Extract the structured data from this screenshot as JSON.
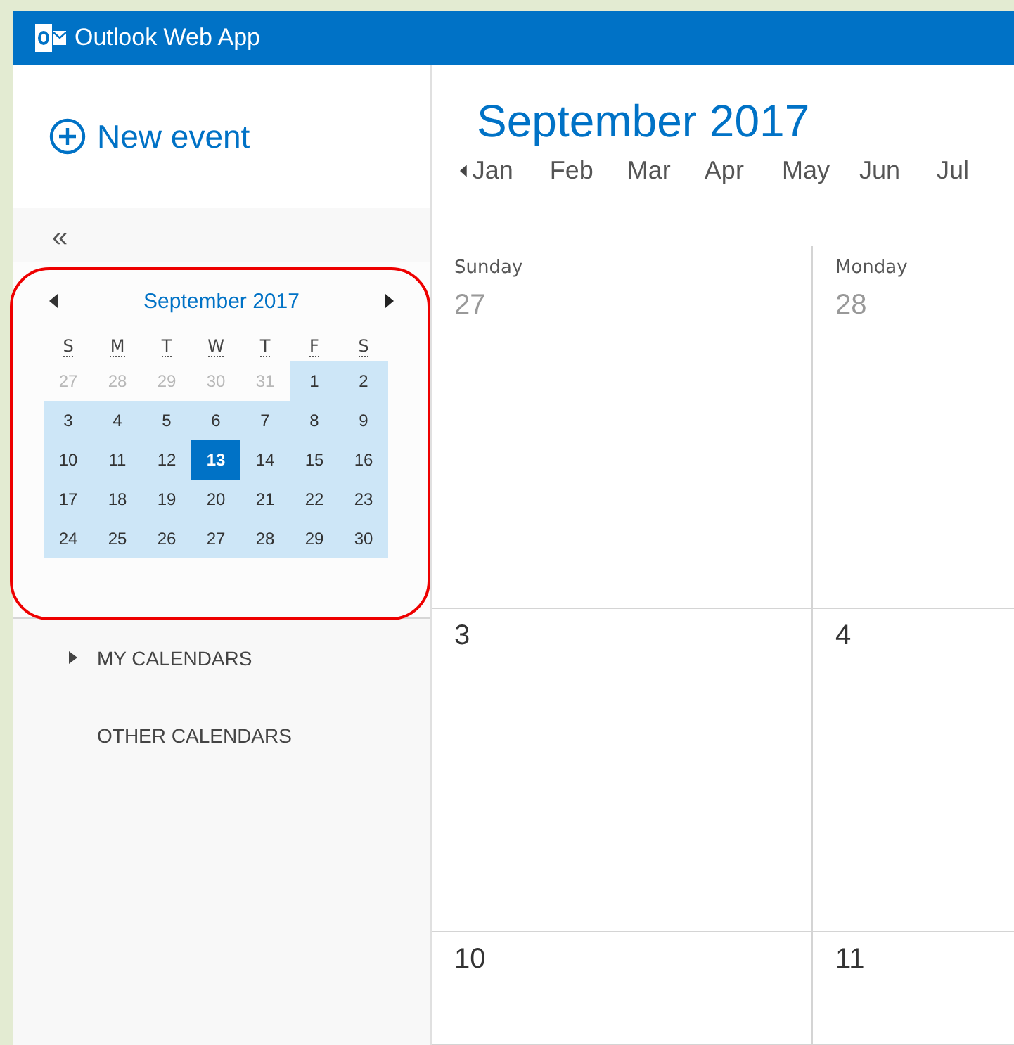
{
  "header": {
    "title": "Outlook Web App"
  },
  "new_event": {
    "label": "New event"
  },
  "collapse": {
    "label": "«"
  },
  "mini_calendar": {
    "title": "September 2017",
    "weekdays": [
      "S",
      "M",
      "T",
      "W",
      "T",
      "F",
      "S"
    ],
    "weeks": [
      [
        {
          "day": "27",
          "outside": true,
          "selected": false
        },
        {
          "day": "28",
          "outside": true,
          "selected": false
        },
        {
          "day": "29",
          "outside": true,
          "selected": false
        },
        {
          "day": "30",
          "outside": true,
          "selected": false
        },
        {
          "day": "31",
          "outside": true,
          "selected": false
        },
        {
          "day": "1",
          "outside": false,
          "selected": false
        },
        {
          "day": "2",
          "outside": false,
          "selected": false
        }
      ],
      [
        {
          "day": "3",
          "outside": false,
          "selected": false
        },
        {
          "day": "4",
          "outside": false,
          "selected": false
        },
        {
          "day": "5",
          "outside": false,
          "selected": false
        },
        {
          "day": "6",
          "outside": false,
          "selected": false
        },
        {
          "day": "7",
          "outside": false,
          "selected": false
        },
        {
          "day": "8",
          "outside": false,
          "selected": false
        },
        {
          "day": "9",
          "outside": false,
          "selected": false
        }
      ],
      [
        {
          "day": "10",
          "outside": false,
          "selected": false
        },
        {
          "day": "11",
          "outside": false,
          "selected": false
        },
        {
          "day": "12",
          "outside": false,
          "selected": false
        },
        {
          "day": "13",
          "outside": false,
          "selected": true
        },
        {
          "day": "14",
          "outside": false,
          "selected": false
        },
        {
          "day": "15",
          "outside": false,
          "selected": false
        },
        {
          "day": "16",
          "outside": false,
          "selected": false
        }
      ],
      [
        {
          "day": "17",
          "outside": false,
          "selected": false
        },
        {
          "day": "18",
          "outside": false,
          "selected": false
        },
        {
          "day": "19",
          "outside": false,
          "selected": false
        },
        {
          "day": "20",
          "outside": false,
          "selected": false
        },
        {
          "day": "21",
          "outside": false,
          "selected": false
        },
        {
          "day": "22",
          "outside": false,
          "selected": false
        },
        {
          "day": "23",
          "outside": false,
          "selected": false
        }
      ],
      [
        {
          "day": "24",
          "outside": false,
          "selected": false
        },
        {
          "day": "25",
          "outside": false,
          "selected": false
        },
        {
          "day": "26",
          "outside": false,
          "selected": false
        },
        {
          "day": "27",
          "outside": false,
          "selected": false
        },
        {
          "day": "28",
          "outside": false,
          "selected": false
        },
        {
          "day": "29",
          "outside": false,
          "selected": false
        },
        {
          "day": "30",
          "outside": false,
          "selected": false
        }
      ]
    ]
  },
  "calendars": [
    {
      "label": "MY CALENDARS",
      "expandable": true
    },
    {
      "label": "OTHER CALENDARS",
      "expandable": false
    }
  ],
  "main": {
    "title": "September 2017",
    "months": [
      "Jan",
      "Feb",
      "Mar",
      "Apr",
      "May",
      "Jun",
      "Jul"
    ],
    "columns": [
      "Sunday",
      "Monday"
    ],
    "weeks": [
      [
        {
          "day": "27",
          "outside": true
        },
        {
          "day": "28",
          "outside": true
        }
      ],
      [
        {
          "day": "3",
          "outside": false
        },
        {
          "day": "4",
          "outside": false
        }
      ],
      [
        {
          "day": "10",
          "outside": false
        },
        {
          "day": "11",
          "outside": false
        }
      ]
    ]
  }
}
